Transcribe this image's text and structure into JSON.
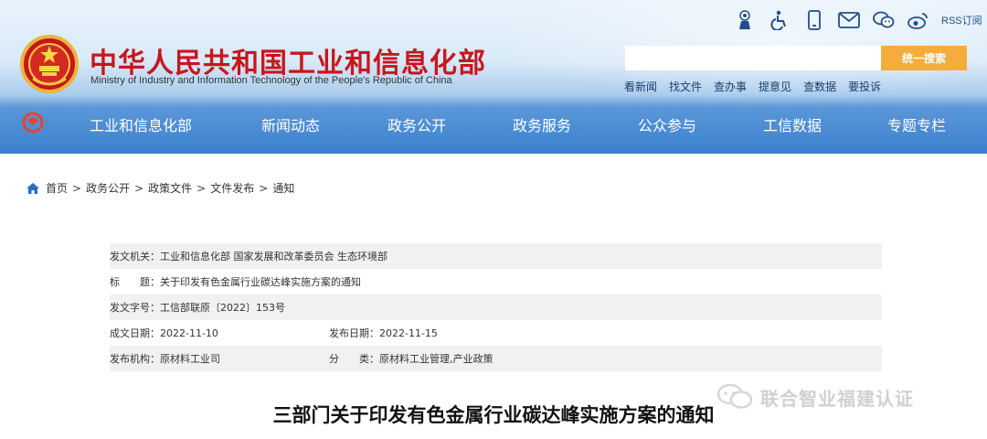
{
  "header": {
    "title": "中华人民共和国工业和信息化部",
    "subtitle": "Ministry of Industry and Information Technology of the People's Republic of China",
    "title_color": "#c8161d",
    "tools": [
      "elder-care-icon",
      "accessibility-icon",
      "mobile-icon",
      "mail-icon",
      "wechat-icon",
      "weibo-icon"
    ],
    "rss_label": "RSS订阅"
  },
  "search": {
    "placeholder": "",
    "button_label": "统一搜索",
    "button_color": "#f4ad3d"
  },
  "quick_links": [
    "看新闻",
    "找文件",
    "查办事",
    "提意见",
    "查数据",
    "要投诉"
  ],
  "nav": {
    "items": [
      "工业和信息化部",
      "新闻动态",
      "政务公开",
      "政务服务",
      "公众参与",
      "工信数据",
      "专题专栏"
    ]
  },
  "breadcrumb": {
    "items": [
      "首页",
      "政务公开",
      "政策文件",
      "文件发布",
      "通知"
    ]
  },
  "meta": {
    "issuer_label": "发文机关：",
    "issuer_value": "工业和信息化部 国家发展和改革委员会 生态环境部",
    "title_label": "标　　题：",
    "title_value": "关于印发有色金属行业碳达峰实施方案的通知",
    "docno_label": "发文字号：",
    "docno_value": "工信部联原〔2022〕153号",
    "created_label": "成文日期：",
    "created_value": "2022-11-10",
    "published_label": "发布日期：",
    "published_value": "2022-11-15",
    "org_label": "发布机构：",
    "org_value": "原材料工业司",
    "category_label": "分　　类：",
    "category_value": "原材料工业管理,产业政策"
  },
  "watermark": "联合智业福建认证",
  "document_title": "三部门关于印发有色金属行业碳达峰实施方案的通知"
}
